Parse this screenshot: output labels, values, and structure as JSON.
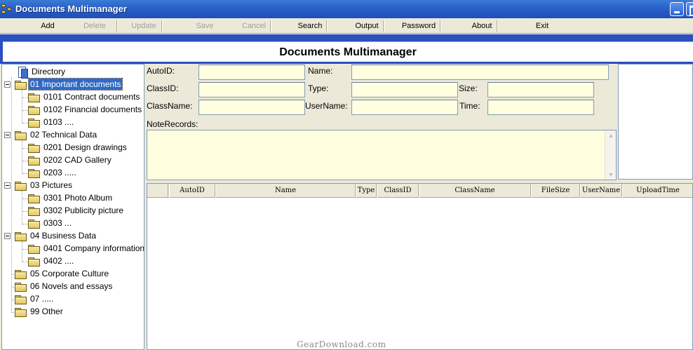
{
  "window": {
    "title": "Documents Multimanager"
  },
  "toolbar": {
    "add": "Add",
    "delete": "Delete",
    "update": "Update",
    "save": "Save",
    "cancel": "Cancel",
    "search": "Search",
    "output": "Output",
    "password": "Password",
    "about": "About",
    "exit": "Exit"
  },
  "header": {
    "title": "Documents Multimanager"
  },
  "tree": {
    "root": "Directory",
    "items": [
      {
        "label": "01 Important documents"
      },
      {
        "label": "0101 Contract documents"
      },
      {
        "label": "0102 Financial documents"
      },
      {
        "label": "0103 ...."
      },
      {
        "label": "02 Technical Data"
      },
      {
        "label": "0201 Design drawings"
      },
      {
        "label": "0202 CAD Gallery"
      },
      {
        "label": "0203 ....."
      },
      {
        "label": "03 Pictures"
      },
      {
        "label": "0301 Photo Album"
      },
      {
        "label": "0302 Publicity picture"
      },
      {
        "label": "0303 ..."
      },
      {
        "label": "04 Business Data"
      },
      {
        "label": "0401 Company information"
      },
      {
        "label": "0402 ...."
      },
      {
        "label": "05 Corporate Culture"
      },
      {
        "label": "06 Novels and essays"
      },
      {
        "label": "07 ....."
      },
      {
        "label": "99 Other"
      }
    ]
  },
  "form": {
    "autoid_label": "AutoID:",
    "name_label": "Name:",
    "classid_label": "ClassID:",
    "type_label": "Type:",
    "size_label": "Size:",
    "classname_label": "ClassName:",
    "username_label": "UserName:",
    "time_label": "Time:",
    "noterecords_label": "NoteRecords:",
    "autoid_value": "",
    "name_value": "",
    "classid_value": "",
    "type_value": "",
    "size_value": "",
    "classname_value": "",
    "username_value": "",
    "time_value": "",
    "noterecords_value": ""
  },
  "grid": {
    "columns": [
      "AutoID",
      "Name",
      "Type",
      "ClassID",
      "ClassName",
      "FileSize",
      "UserName",
      "UploadTime"
    ]
  },
  "watermark": "GearDownload.com"
}
